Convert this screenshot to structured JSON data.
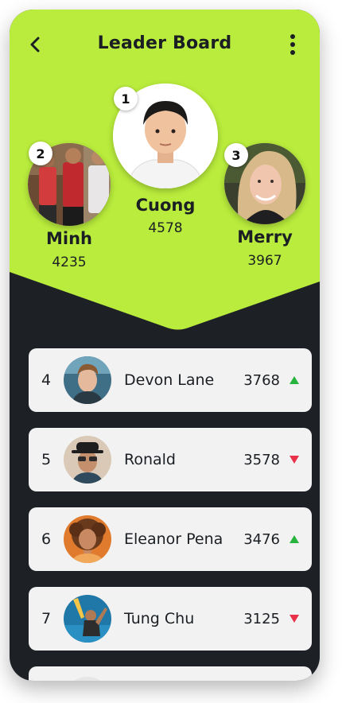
{
  "header": {
    "title": "Leader Board"
  },
  "colors": {
    "accent": "#b9ec3c",
    "background": "#1d2126",
    "card": "#f2f2f2",
    "up": "#27b43e",
    "down": "#e83048"
  },
  "podium": [
    {
      "rank": "1",
      "name": "Cuong",
      "score": "4578"
    },
    {
      "rank": "2",
      "name": "Minh",
      "score": "4235"
    },
    {
      "rank": "3",
      "name": "Merry",
      "score": "3967"
    }
  ],
  "rows": [
    {
      "rank": "4",
      "name": "Devon Lane",
      "score": "3768",
      "trend": "up-arrow-icon"
    },
    {
      "rank": "5",
      "name": "Ronald",
      "score": "3578",
      "trend": "down-arrow-icon"
    },
    {
      "rank": "6",
      "name": "Eleanor Pena",
      "score": "3476",
      "trend": "up-arrow-icon"
    },
    {
      "rank": "7",
      "name": "Tung Chu",
      "score": "3125",
      "trend": "down-arrow-icon"
    }
  ]
}
